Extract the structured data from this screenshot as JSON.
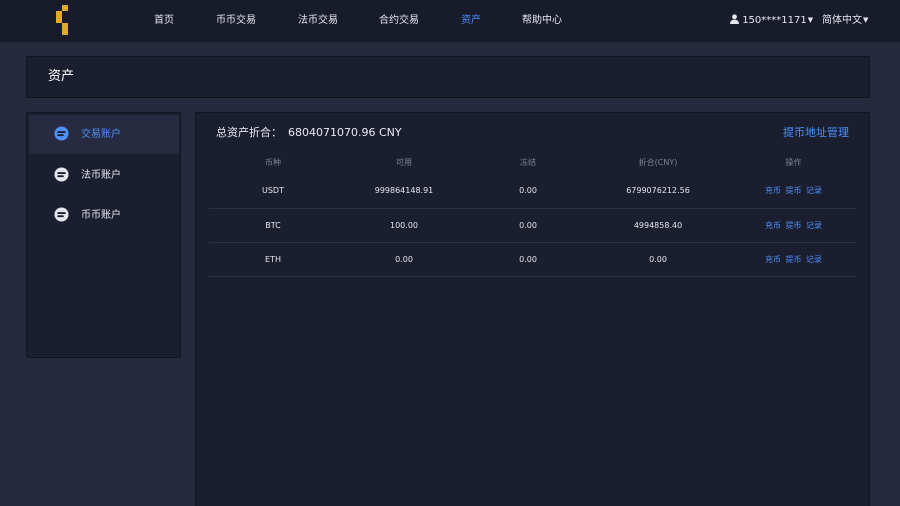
{
  "header": {
    "nav": [
      "首页",
      "币币交易",
      "法币交易",
      "合约交易",
      "资产",
      "帮助中心"
    ],
    "active_nav": "资产",
    "user": "150****1171",
    "language": "简体中文",
    "user_icon": "user-icon",
    "caret_icon": "caret-down-icon"
  },
  "page_title": "资产",
  "sidebar": {
    "items": [
      {
        "label": "交易账户",
        "icon": "wallet-icon",
        "active": true
      },
      {
        "label": "法币账户",
        "icon": "wallet-icon",
        "active": false
      },
      {
        "label": "币币账户",
        "icon": "wallet-icon",
        "active": false
      }
    ]
  },
  "summary": {
    "label": "总资产折合：",
    "value": "6804071070.96 CNY",
    "address_link": "提币地址管理"
  },
  "table": {
    "headers": [
      "币种",
      "可用",
      "冻结",
      "折合(CNY)",
      "操作"
    ],
    "rows": [
      {
        "coin": "USDT",
        "available": "999864148.91",
        "frozen": "0.00",
        "cny": "6799076212.56"
      },
      {
        "coin": "BTC",
        "available": "100.00",
        "frozen": "0.00",
        "cny": "4994858.40"
      },
      {
        "coin": "ETH",
        "available": "0.00",
        "frozen": "0.00",
        "cny": "0.00"
      }
    ],
    "actions": [
      "充币",
      "提币",
      "记录"
    ]
  },
  "colors": {
    "accent": "#4f8ff7",
    "logo": "#e0a92b",
    "background": "#262a3f",
    "panel": "#1b1e2f"
  }
}
